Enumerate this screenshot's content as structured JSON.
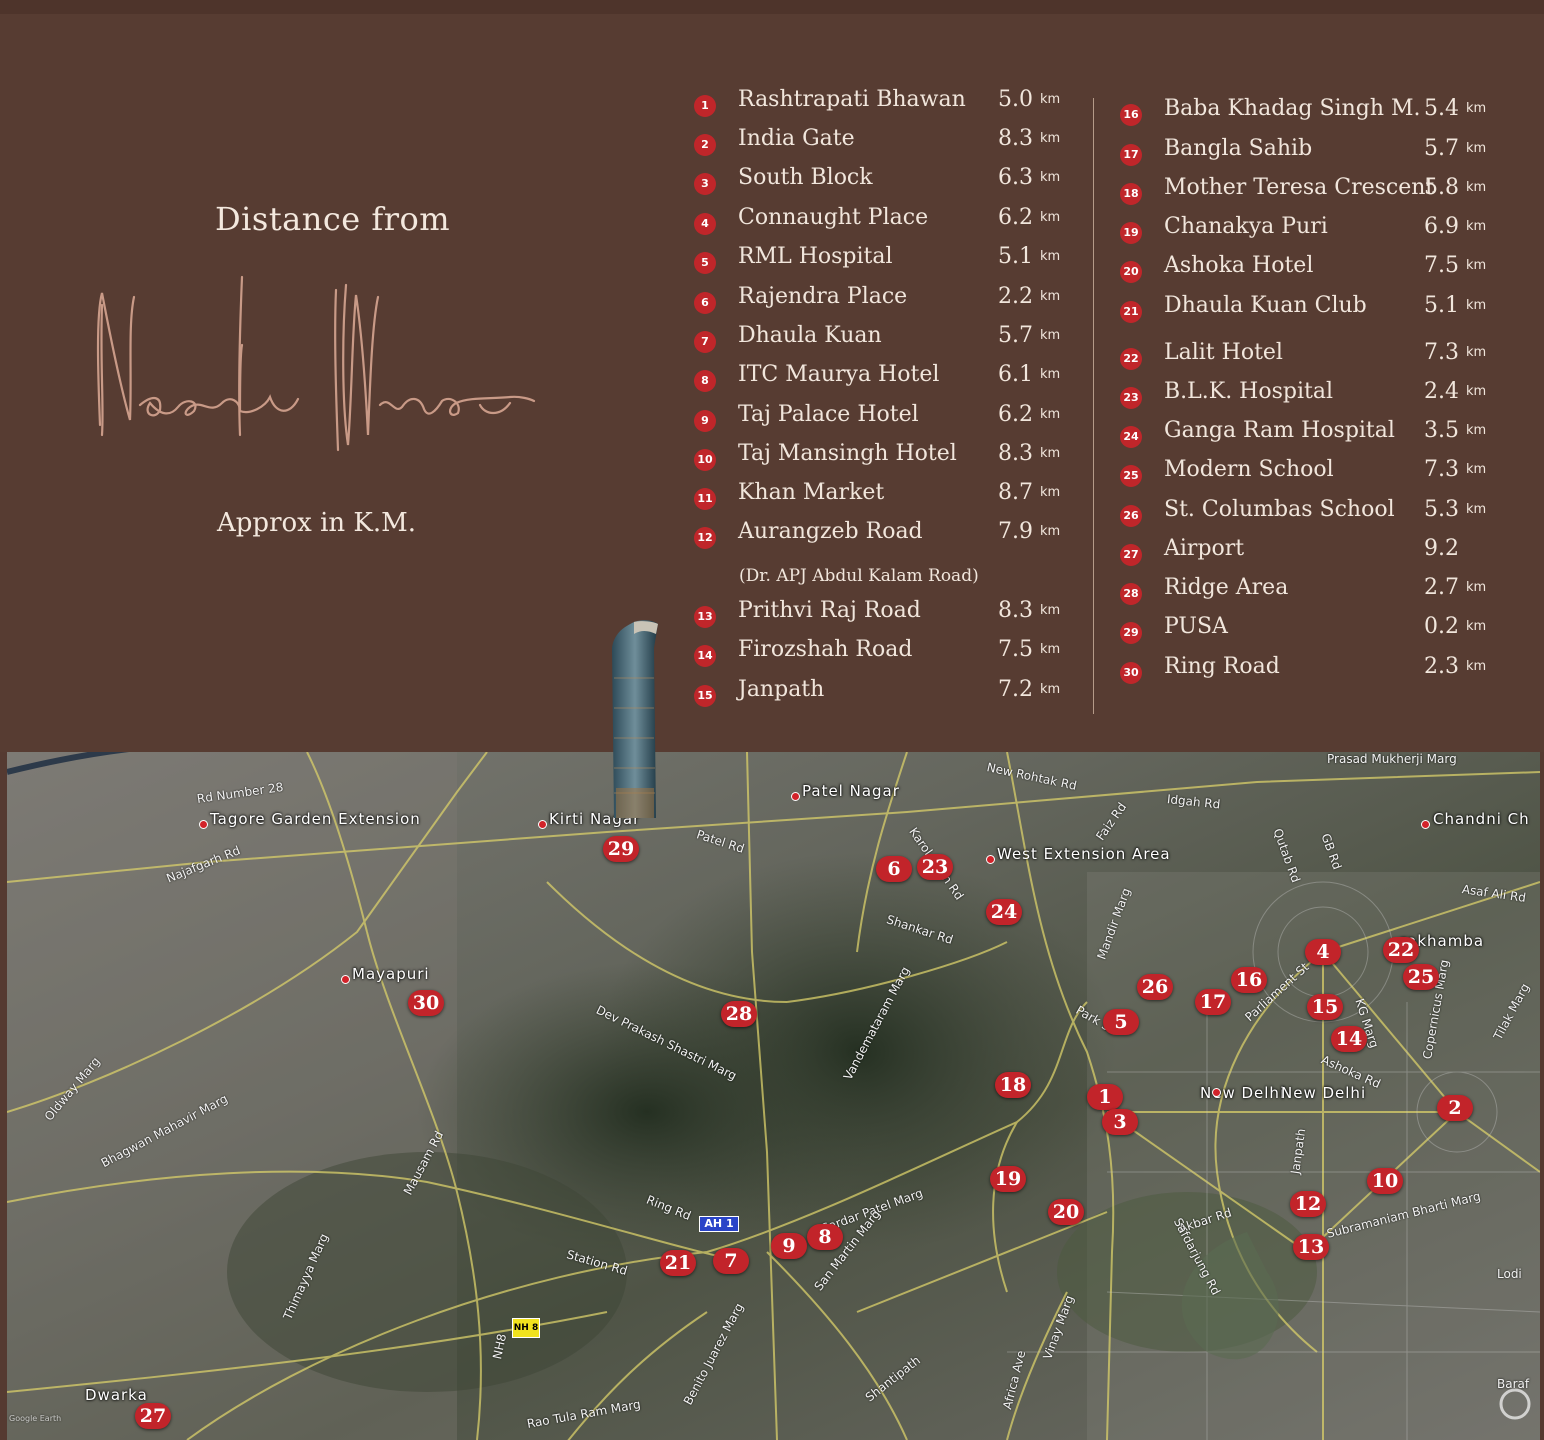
{
  "intro": {
    "title": "Distance from",
    "logo_text": "Nasrin Minar",
    "subtitle": "Approx in K.M."
  },
  "unit": "km",
  "left_list": [
    {
      "n": "1",
      "name": "Rashtrapati Bhawan",
      "dist": "5.0",
      "unit": "km"
    },
    {
      "n": "2",
      "name": "India Gate",
      "dist": "8.3",
      "unit": "km"
    },
    {
      "n": "3",
      "name": "South Block",
      "dist": "6.3",
      "unit": "km"
    },
    {
      "n": "4",
      "name": "Connaught Place",
      "dist": "6.2",
      "unit": "km"
    },
    {
      "n": "5",
      "name": "RML Hospital",
      "dist": "5.1",
      "unit": "km"
    },
    {
      "n": "6",
      "name": "Rajendra Place",
      "dist": "2.2",
      "unit": "km"
    },
    {
      "n": "7",
      "name": "Dhaula Kuan",
      "dist": "5.7",
      "unit": "km"
    },
    {
      "n": "8",
      "name": "ITC Maurya Hotel",
      "dist": "6.1",
      "unit": "km"
    },
    {
      "n": "9",
      "name": "Taj Palace Hotel",
      "dist": "6.2",
      "unit": "km"
    },
    {
      "n": "10",
      "name": "Taj Mansingh Hotel",
      "dist": "8.3",
      "unit": "km"
    },
    {
      "n": "11",
      "name": "Khan Market",
      "dist": "8.7",
      "unit": "km"
    },
    {
      "n": "12",
      "name": "Aurangzeb Road",
      "dist": "7.9",
      "unit": "km"
    },
    {
      "n": "13",
      "name": "Prithvi Raj Road",
      "dist": "8.3",
      "unit": "km"
    },
    {
      "n": "14",
      "name": "Firozshah Road",
      "dist": "7.5",
      "unit": "km"
    },
    {
      "n": "15",
      "name": "Janpath",
      "dist": "7.2",
      "unit": "km"
    }
  ],
  "note_12": "(Dr. APJ Abdul Kalam Road)",
  "right_list": [
    {
      "n": "16",
      "name": "Baba Khadag Singh M.",
      "dist": "5.4",
      "unit": "km"
    },
    {
      "n": "17",
      "name": "Bangla Sahib",
      "dist": "5.7",
      "unit": "km"
    },
    {
      "n": "18",
      "name": "Mother Teresa Crescent",
      "dist": "5.8",
      "unit": "km"
    },
    {
      "n": "19",
      "name": "Chanakya Puri",
      "dist": "6.9",
      "unit": "km"
    },
    {
      "n": "20",
      "name": "Ashoka Hotel",
      "dist": "7.5",
      "unit": "km"
    },
    {
      "n": "21",
      "name": "Dhaula Kuan Club",
      "dist": "5.1",
      "unit": "km"
    },
    {
      "n": "22",
      "name": "Lalit Hotel",
      "dist": "7.3",
      "unit": "km"
    },
    {
      "n": "23",
      "name": "B.L.K. Hospital",
      "dist": "2.4",
      "unit": "km"
    },
    {
      "n": "24",
      "name": "Ganga Ram Hospital",
      "dist": "3.5",
      "unit": "km"
    },
    {
      "n": "25",
      "name": "Modern School",
      "dist": "7.3",
      "unit": "km"
    },
    {
      "n": "26",
      "name": "St. Columbas School",
      "dist": "5.3",
      "unit": "km"
    },
    {
      "n": "27",
      "name": "Airport",
      "dist": "9.2",
      "unit": ""
    },
    {
      "n": "28",
      "name": "Ridge Area",
      "dist": "2.7",
      "unit": "km"
    },
    {
      "n": "29",
      "name": "PUSA",
      "dist": "0.2",
      "unit": "km"
    },
    {
      "n": "30",
      "name": "Ring Road",
      "dist": "2.3",
      "unit": "km"
    }
  ],
  "map": {
    "places": [
      "Patel Nagar",
      "Tagore Garden Extension",
      "Kirti Nagar",
      "West Extension Area",
      "Mayapuri",
      "New Delhi",
      "New Delhi",
      "Chandni Ch",
      "rakhamba",
      "Dwarka"
    ],
    "roads": [
      "Rd Number 28",
      "Najafgarh Rd",
      "Patel Rd",
      "New Rohtak Rd",
      "Idgah Rd",
      "Qutab Rd",
      "GB Rd",
      "Faiz Rd",
      "Karol Bagh Rd",
      "Shankar Rd",
      "Mandir Marg",
      "Asaf Ali Rd",
      "Park St",
      "Dev Prakash Shastri Marg",
      "Vandemataram Marg",
      "Parliament St",
      "Ashoka Rd",
      "KG Marg",
      "Copernicus Marg",
      "Tilak Marg",
      "Ring Rd",
      "Station Rd",
      "Mausam Rd",
      "Bhagwan Mahavir Marg",
      "Sardar Patel Marg",
      "San Martin Marg",
      "Akbar Rd",
      "Safdarjung Rd",
      "Janpath",
      "Subramaniam Bharti Marg",
      "Shantipath",
      "Vinay Marg",
      "Africa Ave",
      "Rao Tula Ram Marg",
      "Benito Juarez Marg",
      "Thimayya Marg",
      "Oldway Marg",
      "Prasad Mukherji Marg",
      "Lodi",
      "Baraf",
      "Google Earth",
      "Ring Rd",
      "NH8"
    ],
    "shields": [
      "AH 1",
      "NH 8"
    ]
  }
}
